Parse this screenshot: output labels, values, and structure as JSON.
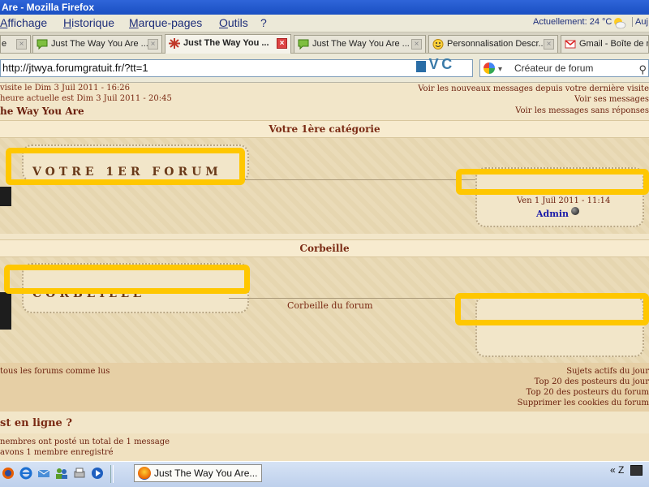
{
  "window": {
    "title": "Are - Mozilla Firefox"
  },
  "menu": {
    "items": [
      {
        "label": "Affichage",
        "u": "A"
      },
      {
        "label": "Historique",
        "u": "H"
      },
      {
        "label": "Marque-pages",
        "u": "M"
      },
      {
        "label": "Outils",
        "u": "O"
      },
      {
        "label": "?",
        "u": ""
      }
    ],
    "weather": "Actuellement: 24 °C",
    "aujourdhui": "Auj"
  },
  "tabs": [
    {
      "label": "e",
      "active": false,
      "icon": "none"
    },
    {
      "label": "Just The Way You Are ...",
      "active": false,
      "icon": "speech-bubble-icon"
    },
    {
      "label": "Just The Way You ...",
      "active": true,
      "icon": "forum-flower-icon"
    },
    {
      "label": "Just The Way You Are ...",
      "active": false,
      "icon": "speech-bubble-icon"
    },
    {
      "label": "Personnalisation Descr...",
      "active": false,
      "icon": "smiley-icon"
    },
    {
      "label": "Gmail - Boîte de ré",
      "active": false,
      "icon": "gmail-icon"
    }
  ],
  "urlbar": {
    "url": "http://jtwya.forumgratuit.fr/?tt=1",
    "search_placeholder": "Créateur de forum"
  },
  "page": {
    "meta": {
      "last_visit": "visite le Dim 3 Juil 2011 - 16:26",
      "current_time": "heure actuelle est Dim 3 Juil 2011 - 20:45",
      "new_messages": "Voir les nouveaux messages depuis votre dernière visite",
      "your_messages": "Voir ses messages",
      "no_reply": "Voir les messages sans réponses"
    },
    "site_title": "he Way You Are",
    "categories": [
      {
        "title": "Votre 1ère catégorie",
        "forum_name": "VOTRE 1ER FORUM",
        "last_post_date": "Ven 1 Juil 2011 - 11:14",
        "last_post_user": "Admin"
      },
      {
        "title": "Corbeille",
        "forum_name": "CORBEILLE",
        "description": "Corbeille du forum"
      }
    ],
    "footer": {
      "mark_read": "tous les forums comme lus",
      "links": [
        "Sujets actifs du jour",
        "Top 20 des posteurs du jour",
        "Top 20 des posteurs du forum",
        "Supprimer les cookies du forum"
      ]
    },
    "online": {
      "header": "st en ligne ?",
      "line1": "nembres ont posté un total de 1 message",
      "line2": "avons 1 membre enregistré"
    }
  },
  "taskbar": {
    "task_label": "Just The Way You Are...",
    "tray": "« Z"
  },
  "colors": {
    "highlight": "#ffc700",
    "link": "#6a1e0c",
    "accent": "#7a2a14"
  }
}
